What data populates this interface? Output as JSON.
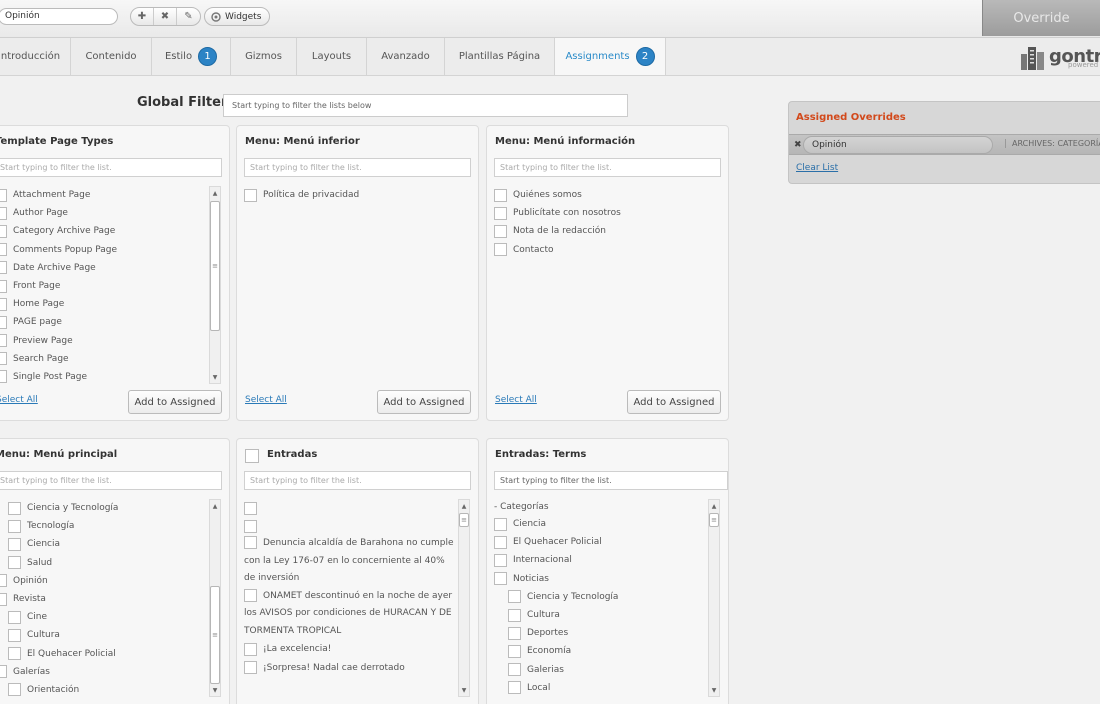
{
  "topbar": {
    "override_name": "Opinión",
    "tools": [
      {
        "icon": "plus-icon",
        "glyph": "✚"
      },
      {
        "icon": "delete-icon",
        "glyph": "✖"
      },
      {
        "icon": "pencil-icon",
        "glyph": "✎"
      }
    ],
    "widgets_label": "Widgets",
    "override_tab_label": "Override"
  },
  "tabs": [
    {
      "label": "Introducción",
      "badge": null
    },
    {
      "label": "Contenido",
      "badge": null
    },
    {
      "label": "Estilo",
      "badge": "1"
    },
    {
      "label": "Gizmos",
      "badge": null
    },
    {
      "label": "Layouts",
      "badge": null
    },
    {
      "label": "Avanzado",
      "badge": null
    },
    {
      "label": "Plantillas Página",
      "badge": null
    },
    {
      "label": "Assignments",
      "badge": "2",
      "active": true
    }
  ],
  "brand": {
    "name": "gontr",
    "sub": "powered"
  },
  "global_filter": {
    "label": "Global Filter",
    "placeholder": "Start typing to filter the lists below"
  },
  "common": {
    "filter_placeholder": "Start typing to filter the list.",
    "select_all": "Select All",
    "add_to_assigned": "Add to Assigned"
  },
  "panels": {
    "template_page_types": {
      "title": "Template Page Types",
      "items": [
        "Attachment Page",
        "Author Page",
        "Category Archive Page",
        "Comments Popup Page",
        "Date Archive Page",
        "Front Page",
        "Home Page",
        "PAGE page",
        "Preview Page",
        "Search Page",
        "Single Post Page"
      ]
    },
    "menu_inferior": {
      "title": "Menu: Menú inferior",
      "items": [
        "Política de privacidad"
      ]
    },
    "menu_informacion": {
      "title": "Menu: Menú información",
      "items": [
        "Quiénes somos",
        "Publicítate con nosotros",
        "Nota de la redacción",
        "Contacto"
      ]
    },
    "menu_principal": {
      "title": "Menu: Menú principal",
      "items": [
        {
          "label": "Ciencia y Tecnología",
          "indent": 1
        },
        {
          "label": "Tecnología",
          "indent": 1
        },
        {
          "label": "Ciencia",
          "indent": 1
        },
        {
          "label": "Salud",
          "indent": 1
        },
        {
          "label": "Opinión",
          "indent": 0
        },
        {
          "label": "Revista",
          "indent": 0
        },
        {
          "label": "Cine",
          "indent": 1
        },
        {
          "label": "Cultura",
          "indent": 1
        },
        {
          "label": "El Quehacer Policial",
          "indent": 1
        },
        {
          "label": "Galerías",
          "indent": 0
        },
        {
          "label": "Orientación",
          "indent": 1
        }
      ]
    },
    "entradas": {
      "title": "Entradas",
      "items": [
        "",
        "",
        "Denuncia alcaldía de Barahona no cumple con  la Ley 176-07 en lo concerniente al 40% de inversión",
        "ONAMET descontinuó en la noche de ayer los AVISOS por condiciones de HURACAN  Y DE TORMENTA TROPICAL",
        "¡La excelencia!",
        "¡Sorpresa! Nadal cae derrotado"
      ]
    },
    "entradas_terms": {
      "title": "Entradas: Terms",
      "filter_placeholder": "Start typing to filter the list.",
      "category_heading": "- Categorías",
      "items": [
        {
          "label": "Ciencia",
          "indent": 0
        },
        {
          "label": "El Quehacer Policial",
          "indent": 0
        },
        {
          "label": "Internacional",
          "indent": 0
        },
        {
          "label": "Noticias",
          "indent": 0
        },
        {
          "label": "Ciencia y Tecnología",
          "indent": 1
        },
        {
          "label": "Cultura",
          "indent": 1
        },
        {
          "label": "Deportes",
          "indent": 1
        },
        {
          "label": "Economía",
          "indent": 1
        },
        {
          "label": "Galerias",
          "indent": 1
        },
        {
          "label": "Local",
          "indent": 1
        }
      ]
    }
  },
  "assigned_overrides": {
    "title": "Assigned Overrides",
    "items": [
      {
        "name": "Opinión",
        "type": "ARCHIVES: CATEGORÍA"
      }
    ],
    "clear_label": "Clear List"
  }
}
